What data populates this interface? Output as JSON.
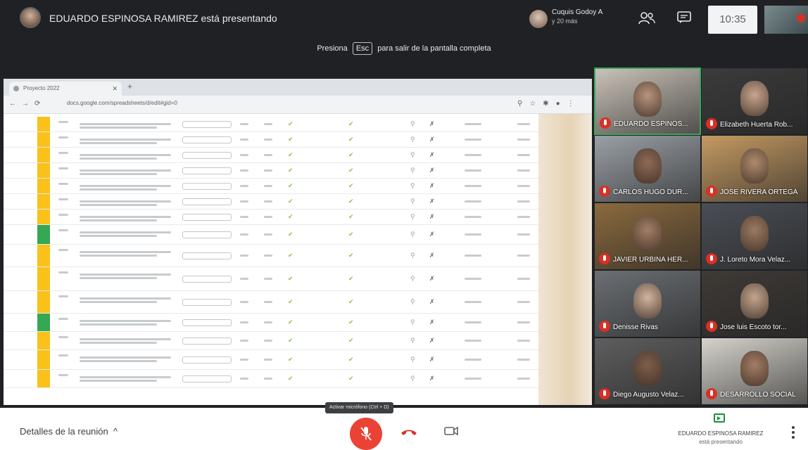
{
  "topbar": {
    "presenter_text": "EDUARDO ESPINOSA RAMIREZ está presentando",
    "others_name": "Cuquis Godoy A",
    "others_more": "y 20 más",
    "clock": "10:35",
    "people_icon": "people-icon",
    "chat_icon": "chat-icon"
  },
  "fullscreen_hint": {
    "prefix": "Presiona",
    "key": "Esc",
    "suffix": "para salir de la pantalla completa"
  },
  "browser": {
    "tab_label": "Proyecto 2022",
    "url": "docs.google.com/spreadsheets/d/edit#gid=0"
  },
  "participants": [
    {
      "name": "EDUARDO ESPINOS...",
      "mic": "muted",
      "active": true,
      "skin": "#b8947c",
      "bg": "#c9c2b8"
    },
    {
      "name": "Elizabeth Huerta Rob...",
      "mic": "muted",
      "active": false,
      "skin": "#c9a58f",
      "bg": "#3b3b3b"
    },
    {
      "name": "CARLOS HUGO DUR...",
      "mic": "muted",
      "active": false,
      "skin": "#8e6a55",
      "bg": "#9aa0a6"
    },
    {
      "name": "JOSE RIVERA ORTEGA",
      "mic": "muted",
      "active": false,
      "skin": "#b08a6c",
      "bg": "#c49a62"
    },
    {
      "name": "JAVIER URBINA HER...",
      "mic": "muted",
      "active": false,
      "skin": "#a37e63",
      "bg": "#8b6a3e"
    },
    {
      "name": "J. Loreto Mora Velaz...",
      "mic": "muted",
      "active": false,
      "skin": "#9c7a62",
      "bg": "#4a4e55"
    },
    {
      "name": "Denisse Rivas",
      "mic": "muted",
      "active": false,
      "skin": "#d2b59e",
      "bg": "#6b6f73"
    },
    {
      "name": "Jose luis Escoto tor...",
      "mic": "muted",
      "active": false,
      "skin": "#c4a58c",
      "bg": "#3e3a36"
    },
    {
      "name": "Diego Augusto Velaz...",
      "mic": "muted",
      "active": false,
      "skin": "#7e5e4a",
      "bg": "#5e5e5e"
    },
    {
      "name": "DESARROLLO SOCIAL",
      "mic": "muted",
      "active": false,
      "skin": "#a47d64",
      "bg": "#d6d3cc"
    }
  ],
  "bottombar": {
    "details_label": "Detalles de la reunión",
    "mic_tooltip": "Activar micrófono (Ctrl + D)",
    "presenter_name": "EDUARDO ESPINOSA RAMIREZ",
    "presenter_status": "está presentando"
  },
  "colors": {
    "bar_dark": "#202124",
    "mic_red": "#ea4335",
    "active_green": "#3ba55d",
    "sheet_yellow": "#f9c11a",
    "sheet_green": "#34a853"
  }
}
